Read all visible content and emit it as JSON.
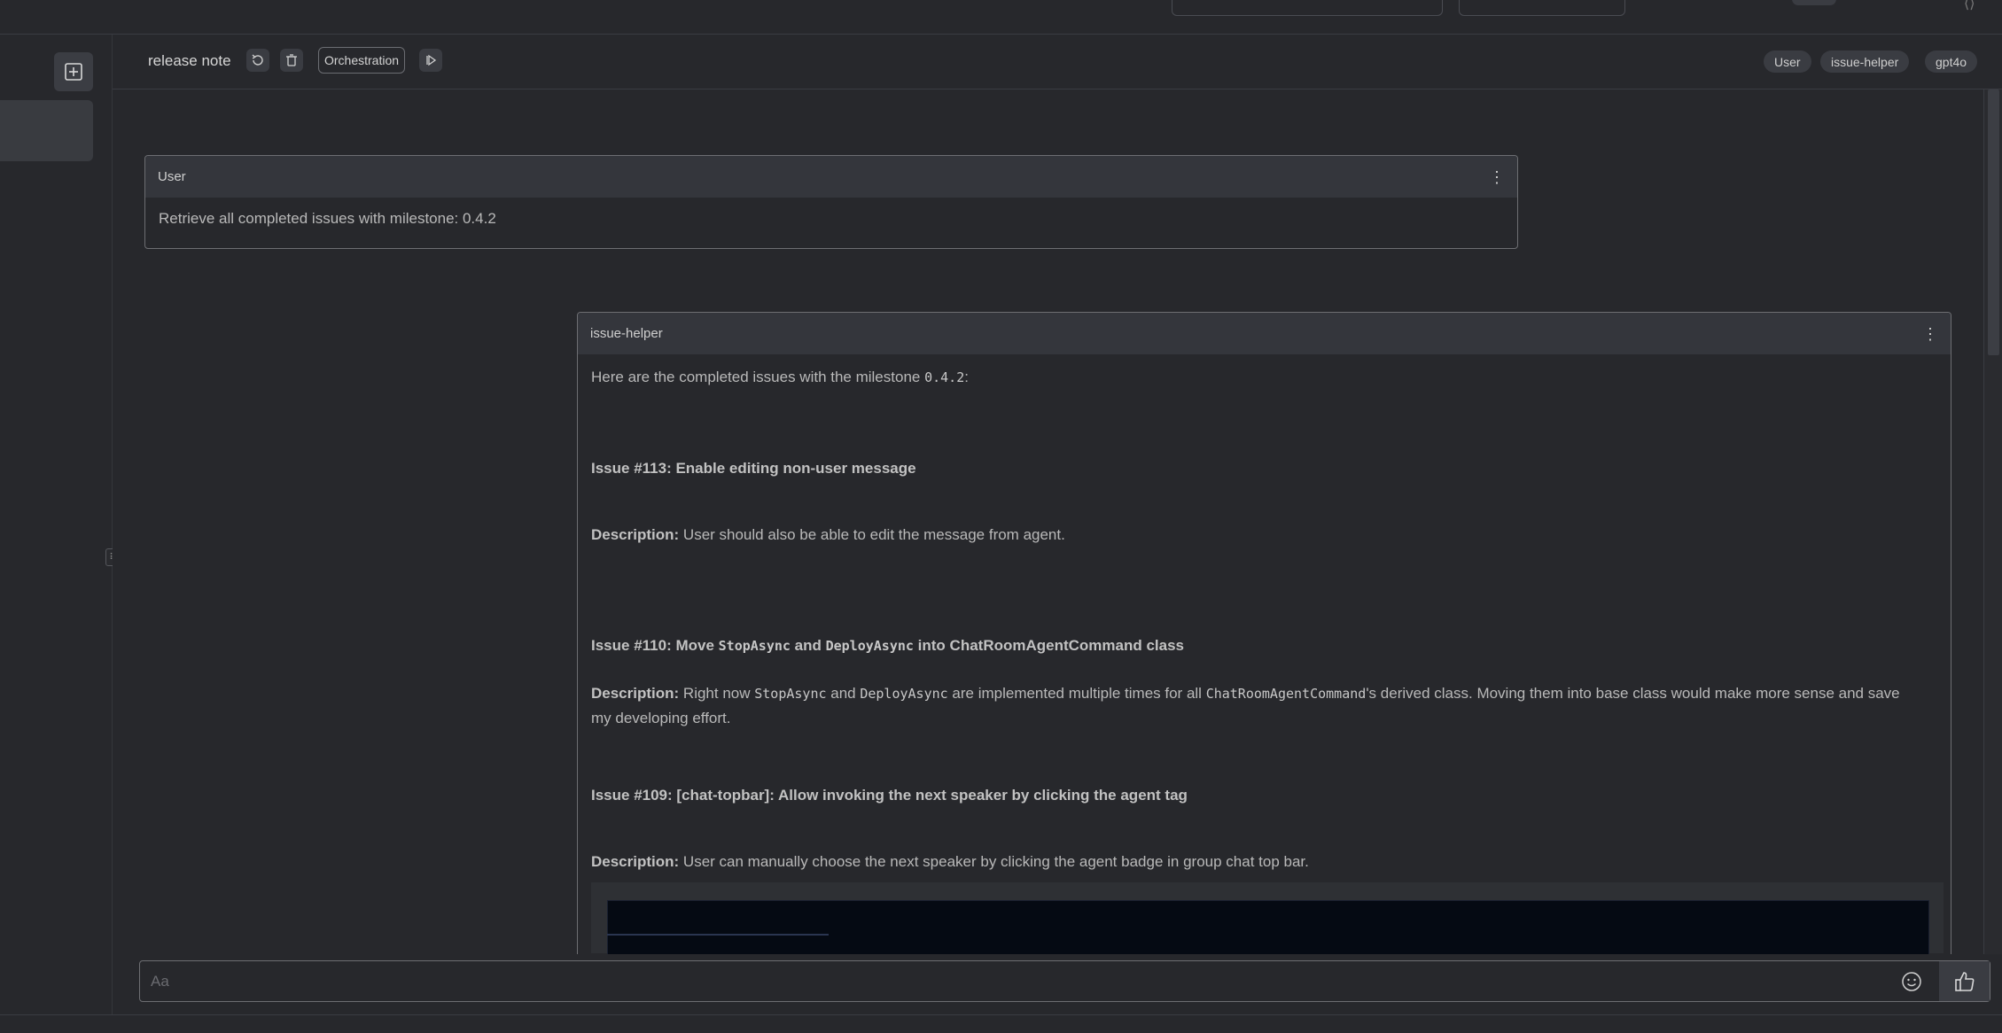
{
  "header": {
    "title": "release note",
    "orchestration_label": "Orchestration",
    "tags": [
      "User",
      "issue-helper",
      "gpt4o"
    ]
  },
  "messages": {
    "user": {
      "sender": "User",
      "text": "Retrieve all completed issues with milestone: 0.4.2"
    },
    "assistant": {
      "sender": "issue-helper",
      "intro_pre": "Here are the completed issues with the milestone ",
      "intro_code": "0.4.2",
      "intro_post": ":",
      "issue1": {
        "title": "Issue #113: Enable editing non-user message",
        "desc_label": "Description:",
        "desc": " User should also be able to edit the message from agent."
      },
      "issue2": {
        "title_pre": "Issue #110: Move ",
        "title_code1": "StopAsync",
        "title_mid": " and ",
        "title_code2": "DeployAsync",
        "title_post": " into ChatRoomAgentCommand class",
        "desc_label": "Description:",
        "desc_pre": " Right now ",
        "desc_code1": "StopAsync",
        "desc_mid": " and ",
        "desc_code2": "DeployAsync",
        "desc_mid2": " are implemented multiple times for all ",
        "desc_code3": "ChatRoomAgentCommand",
        "desc_post": "'s derived class. Moving them into base class would make more sense and save my developing effort."
      },
      "issue3": {
        "title": "Issue #109: [chat-topbar]: Allow invoking the next speaker by clicking the agent tag",
        "desc_label": "Description:",
        "desc": " User can manually choose the next speaker by clicking the agent badge in group chat top bar."
      }
    }
  },
  "composer": {
    "placeholder": "Aa"
  },
  "icons": {
    "add": "add-square-icon",
    "refresh": "refresh-icon",
    "delete": "trash-icon",
    "run": "play-next-icon",
    "kebab": "more-vertical-icon",
    "emoji": "emoji-icon",
    "like": "thumbs-up-icon"
  }
}
